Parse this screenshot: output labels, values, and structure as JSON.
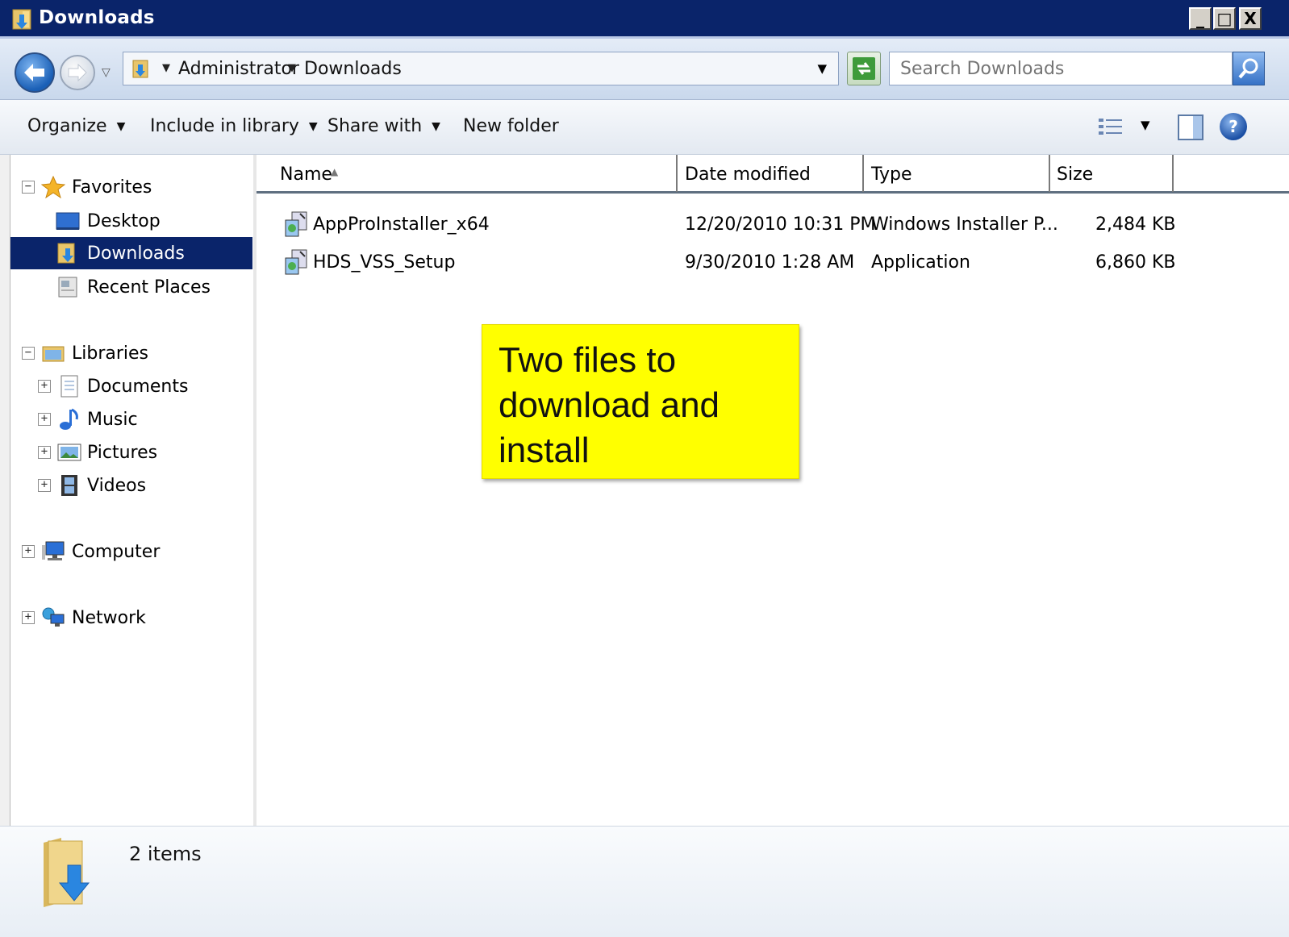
{
  "window": {
    "title": "Downloads",
    "minimize_label": "_",
    "maximize_label": "□",
    "close_label": "X"
  },
  "address": {
    "crumbs": [
      "Administrator",
      "Downloads"
    ],
    "search_placeholder": "Search Downloads"
  },
  "toolbar": {
    "organize": "Organize",
    "include_in_library": "Include in library",
    "share_with": "Share with",
    "new_folder": "New folder",
    "help_label": "?"
  },
  "nav": {
    "favorites": "Favorites",
    "desktop": "Desktop",
    "downloads": "Downloads",
    "recent_places": "Recent Places",
    "libraries": "Libraries",
    "documents": "Documents",
    "music": "Music",
    "pictures": "Pictures",
    "videos": "Videos",
    "computer": "Computer",
    "network": "Network",
    "collapse_symbol": "−",
    "expand_symbol": "+"
  },
  "columns": {
    "name": "Name",
    "date_modified": "Date modified",
    "type": "Type",
    "size": "Size"
  },
  "files": [
    {
      "name": "AppProInstaller_x64",
      "date": "12/20/2010 10:31 PM",
      "type": "Windows Installer P...",
      "size": "2,484 KB"
    },
    {
      "name": "HDS_VSS_Setup",
      "date": "9/30/2010 1:28 AM",
      "type": "Application",
      "size": "6,860 KB"
    }
  ],
  "callout": {
    "line1": "Two files to",
    "line2": "download and",
    "line3": "install"
  },
  "status": {
    "item_count": "2 items"
  },
  "colors": {
    "titlebar": "#0a246a",
    "selection": "#0a246a",
    "callout": "#ffff00"
  }
}
